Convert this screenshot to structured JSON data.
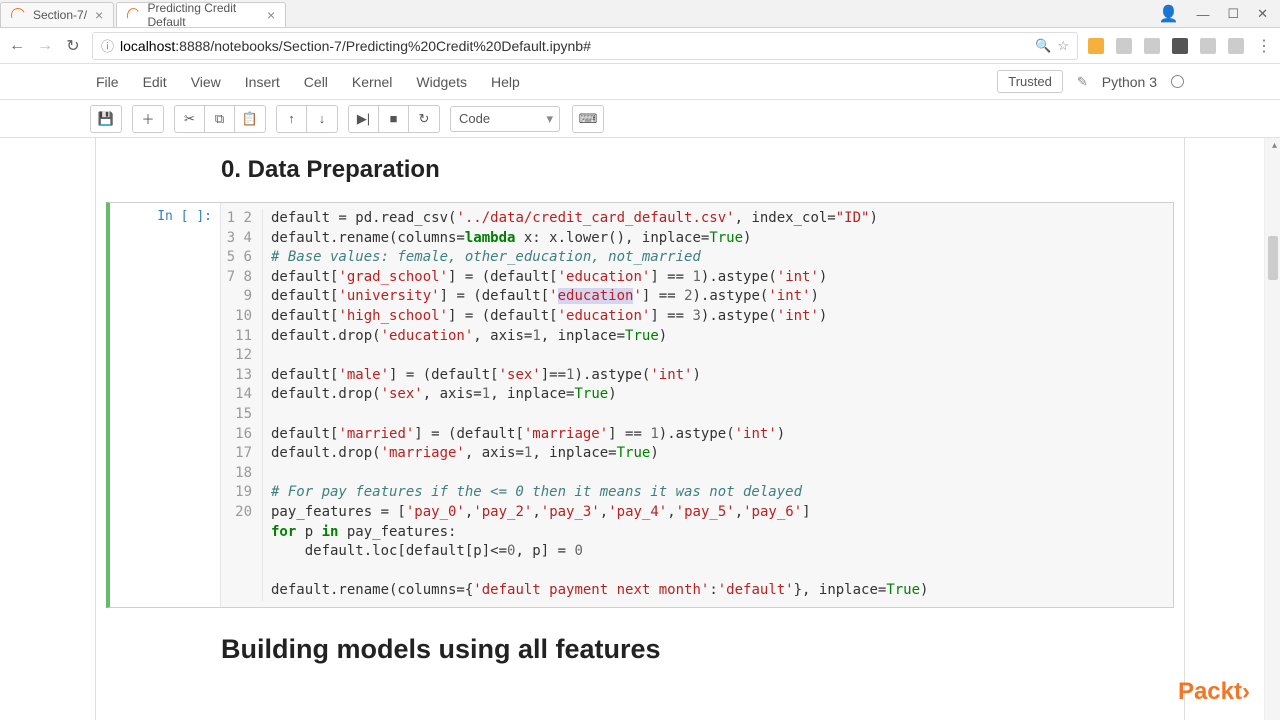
{
  "browser": {
    "tabs": [
      {
        "title": "Section-7/",
        "active": false
      },
      {
        "title": "Predicting Credit Default",
        "active": true
      }
    ],
    "url_prefix_icon": "ⓘ",
    "url_host": "localhost",
    "url_port_path": ":8888/notebooks/Section-7/Predicting%20Credit%20Default.ipynb#",
    "user_icon": "👤",
    "minimize": "—",
    "maximize": "☐",
    "close": "✕"
  },
  "menu": {
    "items": [
      "File",
      "Edit",
      "View",
      "Insert",
      "Cell",
      "Kernel",
      "Widgets",
      "Help"
    ],
    "trusted": "Trusted",
    "edit_icon": "✎",
    "kernel": "Python 3"
  },
  "toolbar": {
    "save": "💾",
    "add": "＋",
    "cut": "✂",
    "copy": "⧉",
    "paste": "📋",
    "up": "↑",
    "down": "↓",
    "run": "▶|",
    "stop": "■",
    "restart": "↻",
    "celltype": "Code",
    "cmd": "⌨"
  },
  "headings": {
    "h1": "0. Data Preparation",
    "h2": "Building models using all features"
  },
  "cell": {
    "prompt": "In [ ]:",
    "line_count": 20
  },
  "watermark": "Packt›",
  "chart_data": null
}
